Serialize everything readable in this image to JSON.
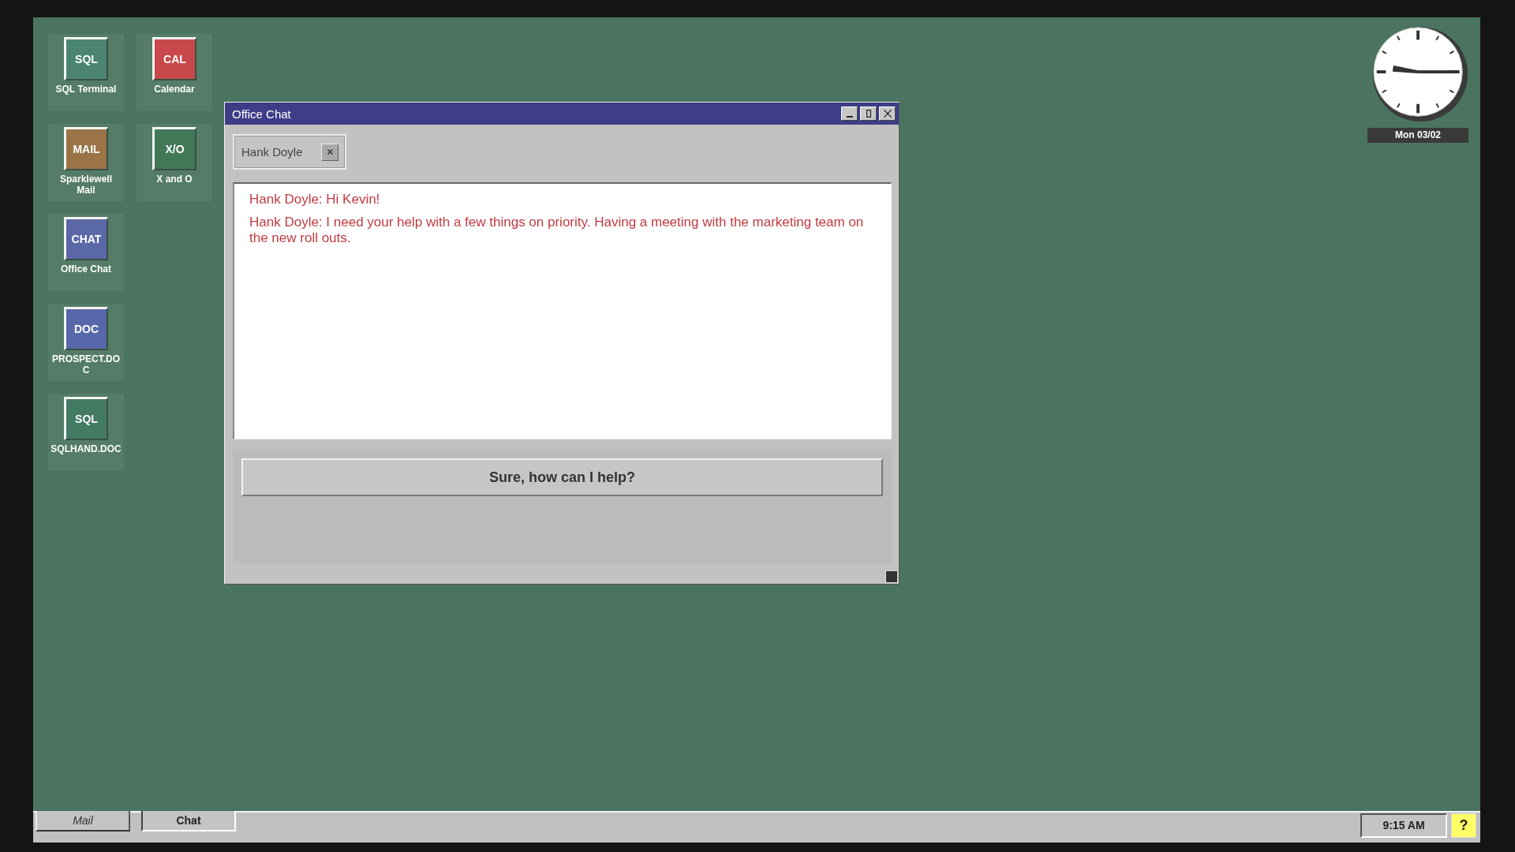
{
  "desktop_icons": [
    [
      {
        "glyph": "SQL",
        "label": "SQL Terminal",
        "color": "#4b8572"
      },
      {
        "glyph": "CAL",
        "label": "Calendar",
        "color": "#c9484b"
      }
    ],
    [
      {
        "glyph": "MAIL",
        "label": "Sparklewell Mail",
        "color": "#9a7447"
      },
      {
        "glyph": "X/O",
        "label": "X and O",
        "color": "#427858"
      }
    ],
    [
      {
        "glyph": "CHAT",
        "label": "Office Chat",
        "color": "#5b68a8"
      }
    ],
    [
      {
        "glyph": "DOC",
        "label": "PROSPECT.DOC",
        "color": "#5667aa"
      }
    ],
    [
      {
        "glyph": "SQL",
        "label": "SQLHAND.DOC",
        "color": "#427a63"
      }
    ]
  ],
  "window": {
    "title": "Office Chat",
    "chat_tabs": [
      {
        "label": "Hank Doyle"
      }
    ],
    "messages": [
      "Hank Doyle: Hi Kevin!",
      "Hank Doyle: I need your help with a few things on priority. Having a meeting with the marketing team on the new roll outs."
    ],
    "reply_options": [
      "Sure, how can I help?"
    ]
  },
  "clock_widget": {
    "date": "Mon 03/02"
  },
  "taskbar": {
    "buttons": [
      {
        "label": "Mail",
        "selected": false
      },
      {
        "label": "Chat",
        "selected": true
      }
    ],
    "time": "9:15 AM",
    "help": "?"
  }
}
